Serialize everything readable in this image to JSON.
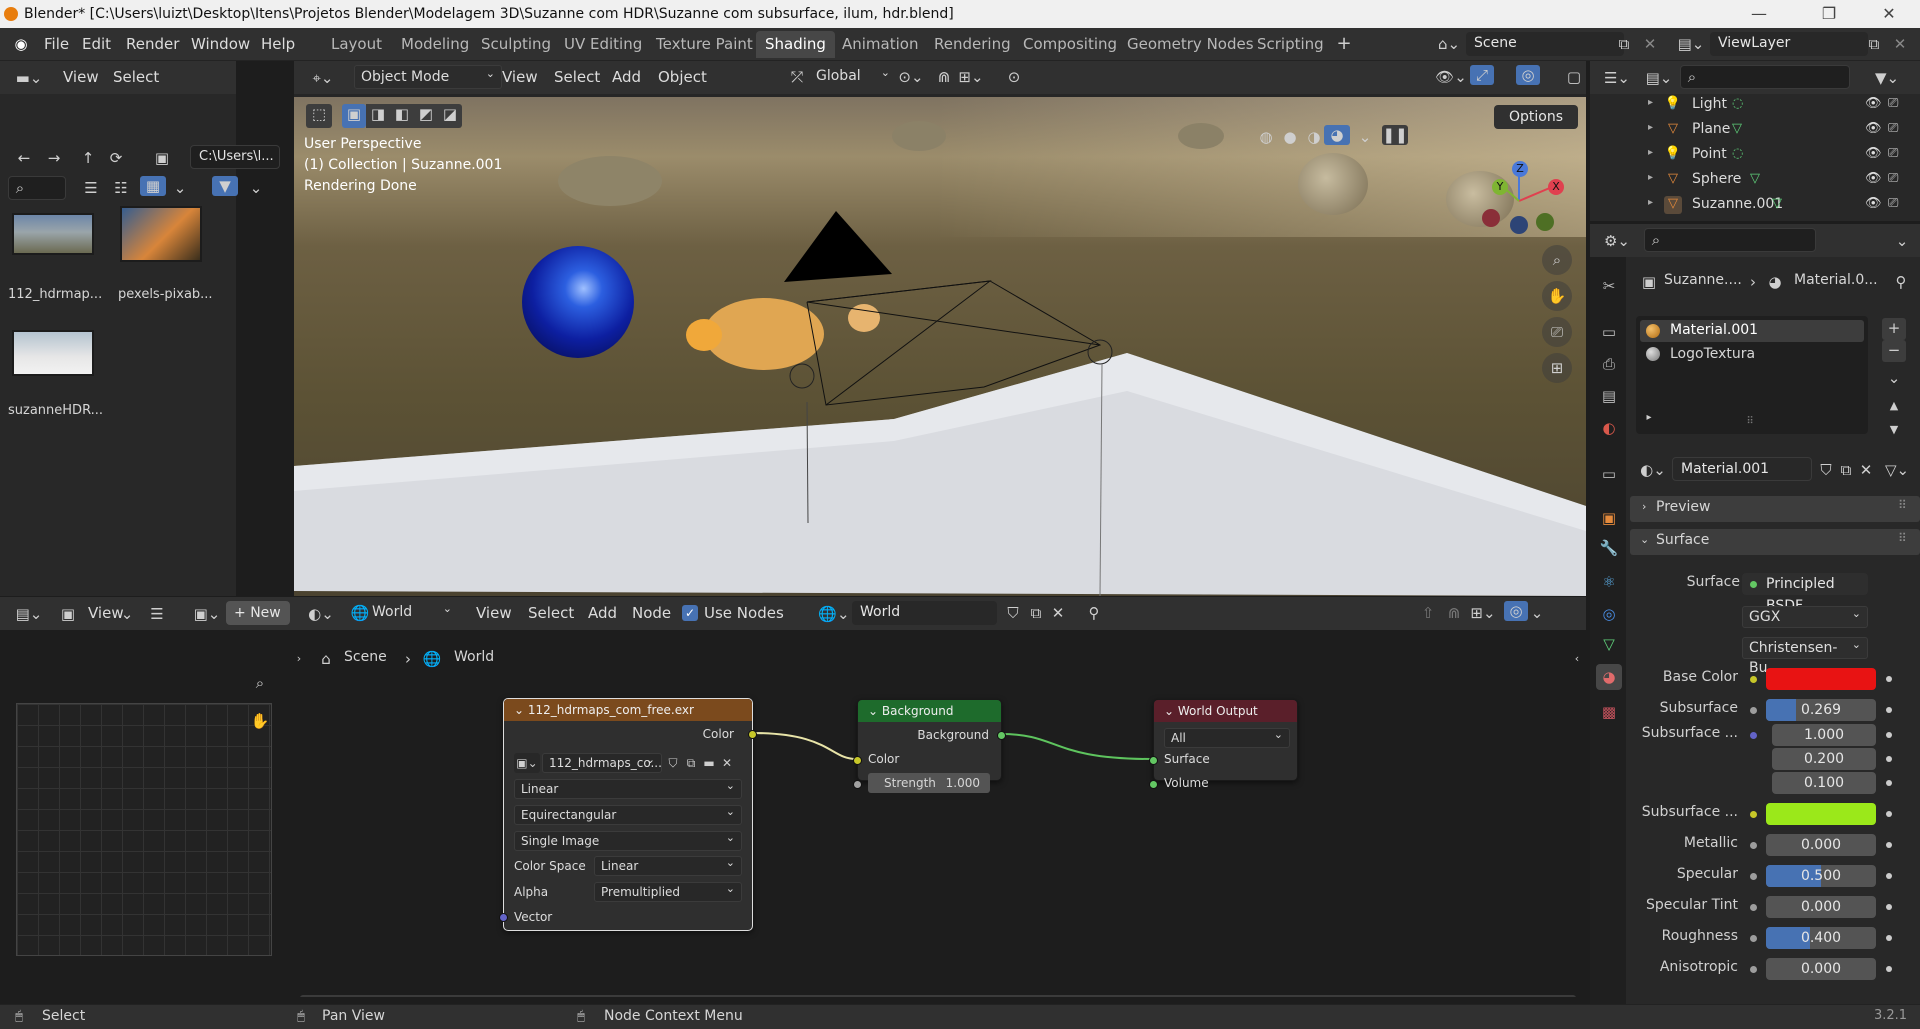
{
  "window": {
    "title": "Blender* [C:\\Users\\luizt\\Desktop\\Itens\\Projetos Blender\\Modelagem 3D\\Suzanne com HDR\\Suzanne com subsurface, ilum, hdr.blend]"
  },
  "menus": [
    "File",
    "Edit",
    "Render",
    "Window",
    "Help"
  ],
  "workspaces": [
    "Layout",
    "Modeling",
    "Sculpting",
    "UV Editing",
    "Texture Paint",
    "Shading",
    "Animation",
    "Rendering",
    "Compositing",
    "Geometry Nodes",
    "Scripting"
  ],
  "active_workspace": "Shading",
  "scene": {
    "name": "Scene",
    "view_layer": "ViewLayer"
  },
  "file_browser": {
    "menus": [
      "View",
      "Select"
    ],
    "path": "C:\\Users\\l...",
    "files": [
      "112_hdrmap...",
      "pexels-pixab...",
      "suzanneHDR..."
    ]
  },
  "viewport": {
    "mode": "Object Mode",
    "menus": [
      "View",
      "Select",
      "Add",
      "Object"
    ],
    "orientation": "Global",
    "options_label": "Options",
    "info": [
      "User Perspective",
      "(1) Collection | Suzanne.001",
      "Rendering Done"
    ],
    "gizmo": {
      "z": "Z",
      "y": "Y",
      "x": "X"
    }
  },
  "image_editor": {
    "view_label": "View",
    "new_label": "New"
  },
  "node_editor": {
    "type": "World",
    "menus": [
      "View",
      "Select",
      "Add",
      "Node"
    ],
    "use_nodes_label": "Use Nodes",
    "world_name": "World",
    "breadcrumb": [
      "Scene",
      "World"
    ]
  },
  "nodes": {
    "env": {
      "title": "112_hdrmaps_com_free.exr",
      "color_out": "Color",
      "image_name": "112_hdrmaps_co...",
      "interp": "Linear",
      "projection": "Equirectangular",
      "source": "Single Image",
      "color_space_label": "Color Space",
      "color_space": "Linear",
      "alpha_label": "Alpha",
      "alpha": "Premultiplied",
      "vector_in": "Vector"
    },
    "bg": {
      "title": "Background",
      "out": "Background",
      "color_in": "Color",
      "strength_label": "Strength",
      "strength": "1.000"
    },
    "out": {
      "title": "World Output",
      "target": "All",
      "surface": "Surface",
      "volume": "Volume"
    }
  },
  "outliner": {
    "items": [
      {
        "name": "Light"
      },
      {
        "name": "Plane"
      },
      {
        "name": "Point"
      },
      {
        "name": "Sphere"
      },
      {
        "name": "Suzanne.001"
      }
    ]
  },
  "properties": {
    "breadcrumb": [
      "Suzanne....",
      "Material.0..."
    ],
    "slots": [
      "Material.001",
      "LogoTextura"
    ],
    "material_name": "Material.001",
    "panels": {
      "preview": "Preview",
      "surface": "Surface"
    },
    "surface_label": "Surface",
    "shader": "Principled BSDF",
    "distribution": "GGX",
    "subsurface_method": "Christensen-Bu...",
    "rows": [
      {
        "label": "Base Color",
        "value": "",
        "color": "#e81313"
      },
      {
        "label": "Subsurface",
        "value": "0.269",
        "fill": 0.269
      },
      {
        "label": "Subsurface ...",
        "value": "1.000"
      },
      {
        "label": "",
        "value": "0.200"
      },
      {
        "label": "",
        "value": "0.100"
      },
      {
        "label": "Subsurface ...",
        "value": "",
        "color": "#9be81a"
      },
      {
        "label": "Metallic",
        "value": "0.000",
        "fill": 0
      },
      {
        "label": "Specular",
        "value": "0.500",
        "fill": 0.5
      },
      {
        "label": "Specular Tint",
        "value": "0.000",
        "fill": 0
      },
      {
        "label": "Roughness",
        "value": "0.400",
        "fill": 0.4
      },
      {
        "label": "Anisotropic",
        "value": "0.000",
        "fill": 0
      }
    ]
  },
  "statusbar": {
    "select": "Select",
    "pan": "Pan View",
    "context": "Node Context Menu",
    "version": "3.2.1"
  }
}
